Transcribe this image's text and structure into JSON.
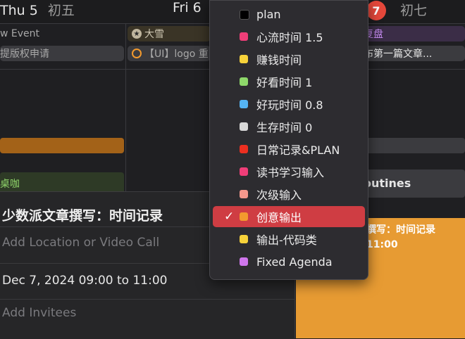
{
  "header": {
    "day1": "Thu 5",
    "day1_lunar": "初五",
    "day2": "Fri 6",
    "today_number": "7",
    "day3_lunar": "初七"
  },
  "allday": {
    "new_event": "w Event",
    "copyright": "提版权申请",
    "daxue": "大雪",
    "ui_logo": "【UI】logo 重",
    "review": "复盘",
    "publish": "布第一篇文章...",
    "routines": "outines",
    "coffee": "桌咖"
  },
  "popover": {
    "title": "少数派文章撰写：时间记录",
    "location_placeholder": "Add Location or Video Call",
    "date_time": "Dec 7, 2024  09:00 to 11:00",
    "invitees_placeholder": "Add Invitees"
  },
  "event_card": {
    "title": "撰写：时间记录",
    "time": "11:00"
  },
  "menu": {
    "items": [
      {
        "label": "plan",
        "color": "#000000"
      },
      {
        "label": "心流时间 1.5",
        "color": "#ef3e78"
      },
      {
        "label": "赚钱时间",
        "color": "#f7d23a"
      },
      {
        "label": "好看时间 1",
        "color": "#8ed86a"
      },
      {
        "label": "好玩时间 0.8",
        "color": "#55b4f3"
      },
      {
        "label": "生存时间 0",
        "color": "#d9d9d9"
      },
      {
        "label": "日常记录&PLAN",
        "color": "#ec2f20"
      },
      {
        "label": "读书学习输入",
        "color": "#ef3e78"
      },
      {
        "label": "次级输入",
        "color": "#f4978c"
      },
      {
        "label": "创意输出",
        "color": "#f39a2e",
        "selected": true
      },
      {
        "label": "输出-代码类",
        "color": "#f7d23a"
      },
      {
        "label": "Fixed Agenda",
        "color": "#cf76ec"
      }
    ],
    "check": "✓"
  }
}
